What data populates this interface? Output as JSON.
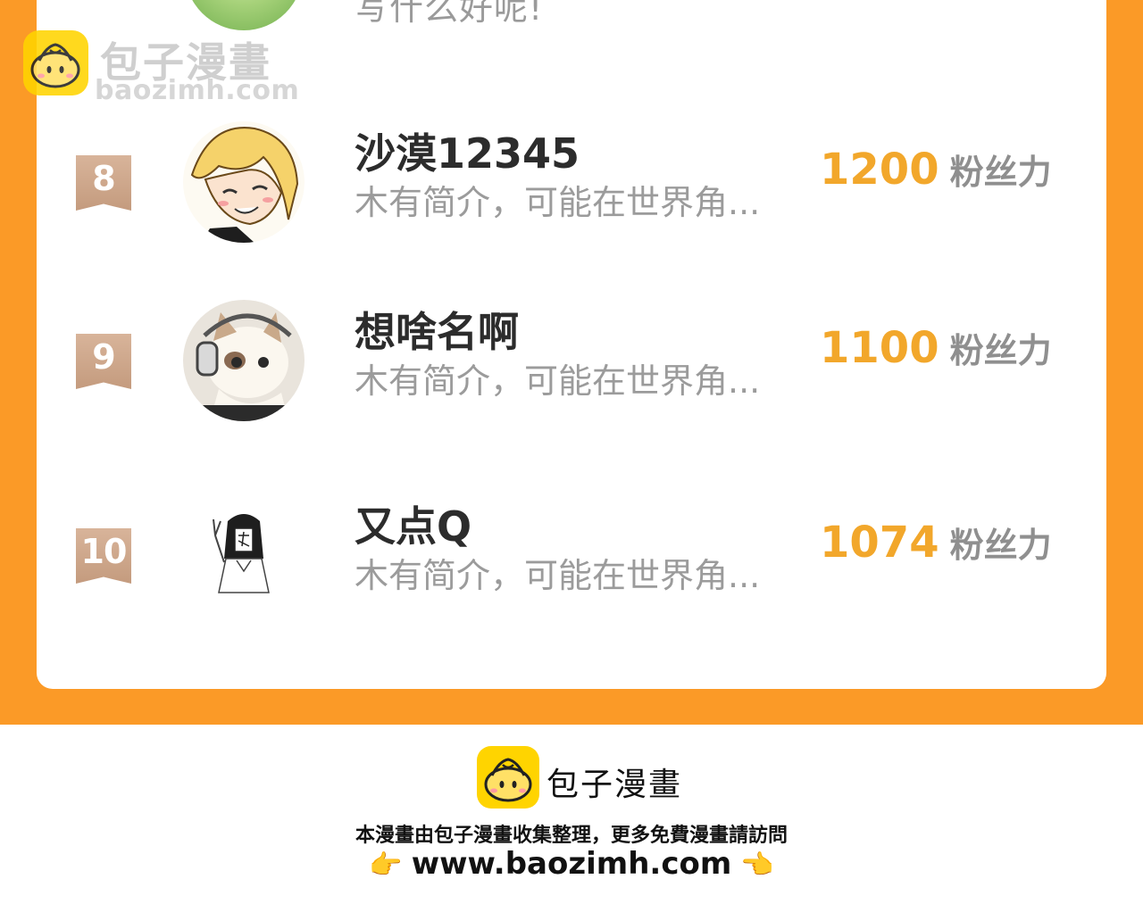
{
  "top_row": {
    "bio": "写什么好呢!"
  },
  "watermark": {
    "name": "包子漫畫",
    "site": "baozimh.com"
  },
  "ranking": [
    {
      "rank": "8",
      "name": "沙漠12345",
      "bio": "木有简介，可能在世界角...",
      "score": "1200",
      "unit": "粉丝力",
      "avatar_icon": "anime-blonde-avatar"
    },
    {
      "rank": "9",
      "name": "想啥名啊",
      "bio": "木有简介，可能在世界角...",
      "score": "1100",
      "unit": "粉丝力",
      "avatar_icon": "cat-headphones-avatar"
    },
    {
      "rank": "10",
      "name": "又点Q",
      "bio": "木有简介，可能在世界角...",
      "score": "1074",
      "unit": "粉丝力",
      "avatar_icon": "sketch-girl-avatar"
    }
  ],
  "footer": {
    "brand": "包子漫畫",
    "notice": "本漫畫由包子漫畫收集整理，更多免費漫畫請訪問",
    "url": "www.baozimh.com",
    "hand_left": "👉",
    "hand_right": "👈"
  },
  "colors": {
    "orange": "#fb9a27",
    "score": "#f2a72b",
    "rank_badge": "#c9a285"
  }
}
